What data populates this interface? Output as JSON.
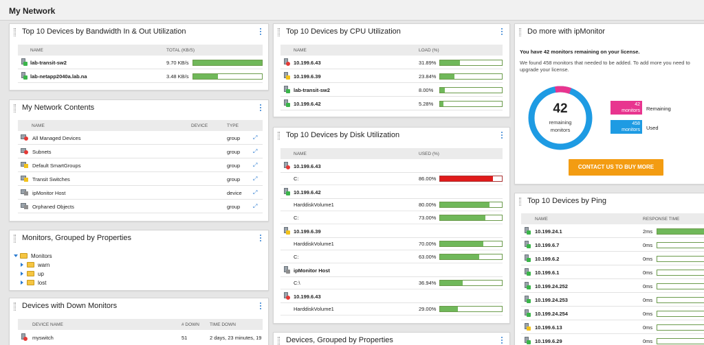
{
  "page": {
    "title": "My Network"
  },
  "bandwidth": {
    "title": "Top 10 Devices by Bandwidth In & Out Utilization",
    "columns": [
      "NAME",
      "TOTAL (KB/S)"
    ],
    "rows": [
      {
        "name": "lab-transit-sw2",
        "value": "9.70 KB/s",
        "fraction": 1.0,
        "status": "green"
      },
      {
        "name": "lab-netapp2040a.lab.na",
        "value": "3.48 KB/s",
        "fraction": 0.36,
        "status": "green"
      }
    ]
  },
  "contents": {
    "title": "My Network Contents",
    "columns": [
      "NAME",
      "DEVICE",
      "TYPE"
    ],
    "rows": [
      {
        "name": "All Managed Devices",
        "device": "",
        "type": "group",
        "icon": "red"
      },
      {
        "name": "Subnets",
        "device": "",
        "type": "group",
        "icon": "red"
      },
      {
        "name": "Default SmartGroups",
        "device": "",
        "type": "group",
        "icon": "yellow"
      },
      {
        "name": "Transit Switches",
        "device": "",
        "type": "group",
        "icon": "yellow"
      },
      {
        "name": "ipMonitor Host",
        "device": "",
        "type": "device",
        "icon": "grey"
      },
      {
        "name": "Orphaned Objects",
        "device": "",
        "type": "group",
        "icon": "grey"
      }
    ]
  },
  "grouped": {
    "title": "Monitors, Grouped by Properties",
    "root": "Monitors",
    "children": [
      "warn",
      "up",
      "lost"
    ]
  },
  "down": {
    "title": "Devices with Down Monitors",
    "columns": [
      "DEVICE NAME",
      "# DOWN",
      "TIME DOWN"
    ],
    "rows": [
      {
        "name": "myswitch",
        "count": "51",
        "time": "2 days, 23 minutes, 19"
      }
    ]
  },
  "cpu": {
    "title": "Top 10 Devices by CPU Utilization",
    "columns": [
      "NAME",
      "LOAD (%)"
    ],
    "rows": [
      {
        "name": "10.199.6.43",
        "value": "31.89%",
        "fraction": 0.3189,
        "status": "red"
      },
      {
        "name": "10.199.6.39",
        "value": "23.84%",
        "fraction": 0.2384,
        "status": "yellow"
      },
      {
        "name": "lab-transit-sw2",
        "value": "8.00%",
        "fraction": 0.08,
        "status": "green"
      },
      {
        "name": "10.199.6.42",
        "value": "5.28%",
        "fraction": 0.0528,
        "status": "green"
      }
    ]
  },
  "disk": {
    "title": "Top 10 Devices by Disk Utilization",
    "columns": [
      "NAME",
      "USED (%)"
    ],
    "groups": [
      {
        "device": "10.199.6.43",
        "status": "red",
        "volumes": [
          {
            "name": "C:",
            "value": "86.00%",
            "fraction": 0.86,
            "critical": true
          }
        ]
      },
      {
        "device": "10.199.6.42",
        "status": "green",
        "volumes": [
          {
            "name": "HarddiskVolume1",
            "value": "80.00%",
            "fraction": 0.8,
            "critical": false
          },
          {
            "name": "C:",
            "value": "73.00%",
            "fraction": 0.73,
            "critical": false
          }
        ]
      },
      {
        "device": "10.199.6.39",
        "status": "yellow",
        "volumes": [
          {
            "name": "HarddiskVolume1",
            "value": "70.00%",
            "fraction": 0.7,
            "critical": false
          },
          {
            "name": "C:",
            "value": "63.00%",
            "fraction": 0.63,
            "critical": false
          }
        ]
      },
      {
        "device": "ipMonitor Host",
        "status": "grey",
        "volumes": [
          {
            "name": "C:\\",
            "value": "36.94%",
            "fraction": 0.3694,
            "critical": false
          }
        ]
      },
      {
        "device": "10.199.6.43",
        "status": "red",
        "volumes": [
          {
            "name": "HarddiskVolume1",
            "value": "29.00%",
            "fraction": 0.29,
            "critical": false
          }
        ]
      }
    ]
  },
  "devgrouped": {
    "title": "Devices, Grouped by Properties"
  },
  "upsell": {
    "title": "Do more with ipMonitor",
    "headline": "You have 42 monitors remaining on your license.",
    "body": "We found 458 monitors that needed to be added. To add more you need to upgrade your license.",
    "donut_number": "42",
    "donut_caption_1": "remaining",
    "donut_caption_2": "monitors",
    "remaining_value": 42,
    "used_value": 458,
    "remaining_color": "#e8358f",
    "used_color": "#1e9be3",
    "remaining_box_num": "42",
    "remaining_box_unit": "monitors",
    "remaining_label": "Remaining",
    "used_box_num": "458",
    "used_box_unit": "monitors",
    "used_label": "Used",
    "cta": "CONTACT US TO BUY MORE"
  },
  "ping": {
    "title": "Top 10 Devices by Ping",
    "columns": [
      "NAME",
      "RESPONSE TIME"
    ],
    "rows": [
      {
        "name": "10.199.24.1",
        "value": "2ms",
        "fraction": 1.0,
        "status": "green"
      },
      {
        "name": "10.199.6.7",
        "value": "0ms",
        "fraction": 0.0,
        "status": "green"
      },
      {
        "name": "10.199.6.2",
        "value": "0ms",
        "fraction": 0.0,
        "status": "green"
      },
      {
        "name": "10.199.6.1",
        "value": "0ms",
        "fraction": 0.0,
        "status": "green"
      },
      {
        "name": "10.199.24.252",
        "value": "0ms",
        "fraction": 0.0,
        "status": "green"
      },
      {
        "name": "10.199.24.253",
        "value": "0ms",
        "fraction": 0.0,
        "status": "green"
      },
      {
        "name": "10.199.24.254",
        "value": "0ms",
        "fraction": 0.0,
        "status": "green"
      },
      {
        "name": "10.199.6.13",
        "value": "0ms",
        "fraction": 0.0,
        "status": "yellow"
      },
      {
        "name": "10.199.6.29",
        "value": "0ms",
        "fraction": 0.0,
        "status": "green"
      }
    ]
  }
}
